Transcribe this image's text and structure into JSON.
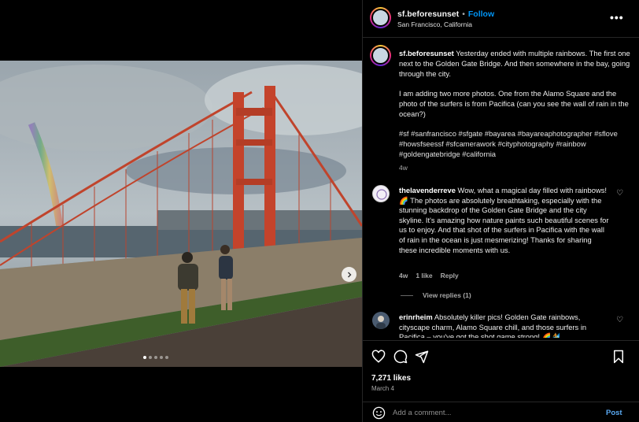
{
  "post": {
    "username": "sf.beforesunset",
    "separator": "•",
    "follow_label": "Follow",
    "location": "San Francisco, California",
    "more_label": "•••"
  },
  "caption": {
    "username": "sf.beforesunset",
    "paragraph1": "Yesterday ended with multiple rainbows. The first one next to the Golden Gate Bridge. And then somewhere in the bay, going through the city.",
    "paragraph2": "I am adding two more photos. One from the Alamo Square and the photo of the surfers is from Pacifica (can you see the wall of rain in the ocean?)",
    "hashtags": "#sf #sanfrancisco #sfgate #bayarea #bayareaphotographer #sflove #howsfseessf #sfcamerawork #cityphotography #rainbow #goldengatebridge #california",
    "age": "4w"
  },
  "comments": [
    {
      "username": "thelavenderreve",
      "text": "Wow, what a magical day filled with rainbows! 🌈 The photos are absolutely breathtaking, especially with the stunning backdrop of the Golden Gate Bridge and the city skyline. It's amazing how nature paints such beautiful scenes for us to enjoy. And that shot of the surfers in Pacifica with the wall of rain in the ocean is just mesmerizing! Thanks for sharing these incredible moments with us.",
      "age": "4w",
      "likes": "1 like",
      "reply_label": "Reply",
      "view_replies": "View replies (1)"
    },
    {
      "username": "erinrheim",
      "text": "Absolutely killer pics! Golden Gate rainbows, cityscape charm, Alamo Square chill, and those surfers in Pacifica – you've got the shot game strong! 🌈🏄"
    }
  ],
  "actions": {
    "likes_count": "7,271 likes",
    "date": "March 4",
    "comment_placeholder": "Add a comment...",
    "post_label": "Post"
  },
  "carousel": {
    "total": 5,
    "active": 0
  },
  "icons": [
    "heart-icon",
    "comment-icon",
    "share-icon",
    "bookmark-icon",
    "emoji-icon",
    "chevron-right-icon",
    "more-icon"
  ],
  "colors": {
    "accent": "#0095f6",
    "background": "#000000",
    "divider": "#262626",
    "muted": "#a8a8a8"
  }
}
